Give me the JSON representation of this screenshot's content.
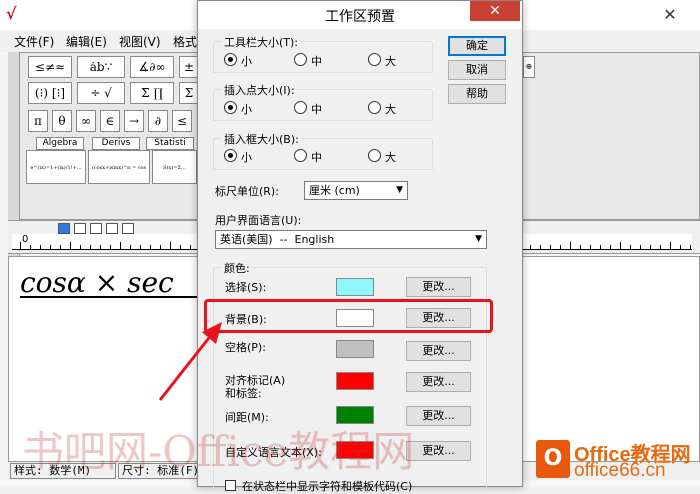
{
  "app": {
    "logo_glyph": "√",
    "close_glyph": "✕",
    "menu": [
      "文件(F)",
      "编辑(E)",
      "视图(V)",
      "格式"
    ],
    "palette_row1": [
      "≤≠≈",
      "ȧb∵",
      "∡∂∞",
      "±"
    ],
    "palette_row2": [
      "(⁝) [⁝]",
      "÷ √",
      "Σ̄ ∏",
      "Σ"
    ],
    "symbol_row": [
      "π",
      "θ",
      "∞",
      "∈",
      "→",
      "∂",
      "≤"
    ],
    "category_tabs": [
      "Algebra",
      "Derivs",
      "Statisti"
    ],
    "templates": [
      "e^(ix)=1+(ix)/1!+...",
      "(cosx+isinx)^n = cos",
      "S(x)=Σ..."
    ],
    "ruler_start": "0",
    "editor_text": "cosα × sec",
    "status_style": "样式: 数学(M)",
    "status_size": "尺寸: 标准(F)"
  },
  "dialog": {
    "title": "工作区预置",
    "close_glyph": "✕",
    "toolbar_size": {
      "label": "工具栏大小(T):",
      "options": [
        "小",
        "中",
        "大"
      ],
      "selected": "小"
    },
    "insertion_point_size": {
      "label": "插入点大小(I):",
      "options": [
        "小",
        "中",
        "大"
      ],
      "selected": "小"
    },
    "insertion_box_size": {
      "label": "插入框大小(B):",
      "options": [
        "小",
        "中",
        "大"
      ],
      "selected": "小"
    },
    "ruler_unit": {
      "label": "标尺单位(R):",
      "value": "厘米 (cm)"
    },
    "ui_language": {
      "label": "用户界面语言(U):",
      "value": "英语(美国)  --  English"
    },
    "colors": {
      "group_label": "颜色:",
      "rows": [
        {
          "label": "选择(S):",
          "color": "#8ff8ff",
          "button": "更改..."
        },
        {
          "label": "背景(B):",
          "color": "#ffffff",
          "button": "更改..."
        },
        {
          "label": "空格(P):",
          "color": "#c0c0c0",
          "button": "更改..."
        },
        {
          "label": "对齐标记(A)\n和标签:",
          "color": "#ff0000",
          "button": "更改..."
        },
        {
          "label": "间距(M):",
          "color": "#008000",
          "button": "更改..."
        },
        {
          "label": "自定义语言文本(X):",
          "color": "#ff0000",
          "button": "更改..."
        }
      ]
    },
    "bottom_checkbox_label": "在状态栏中显示字符和模板代码(C)",
    "buttons": {
      "ok": "确定",
      "cancel": "取消",
      "help": "帮助"
    }
  },
  "watermark": {
    "left_text": "书吧网-Office教程网",
    "brand_icon": "O",
    "brand_line1": "Office教程网",
    "brand_line2": "office66.cn"
  },
  "accent_colors": {
    "highlight": "#e8141a",
    "dialog_close": "#c84031"
  }
}
